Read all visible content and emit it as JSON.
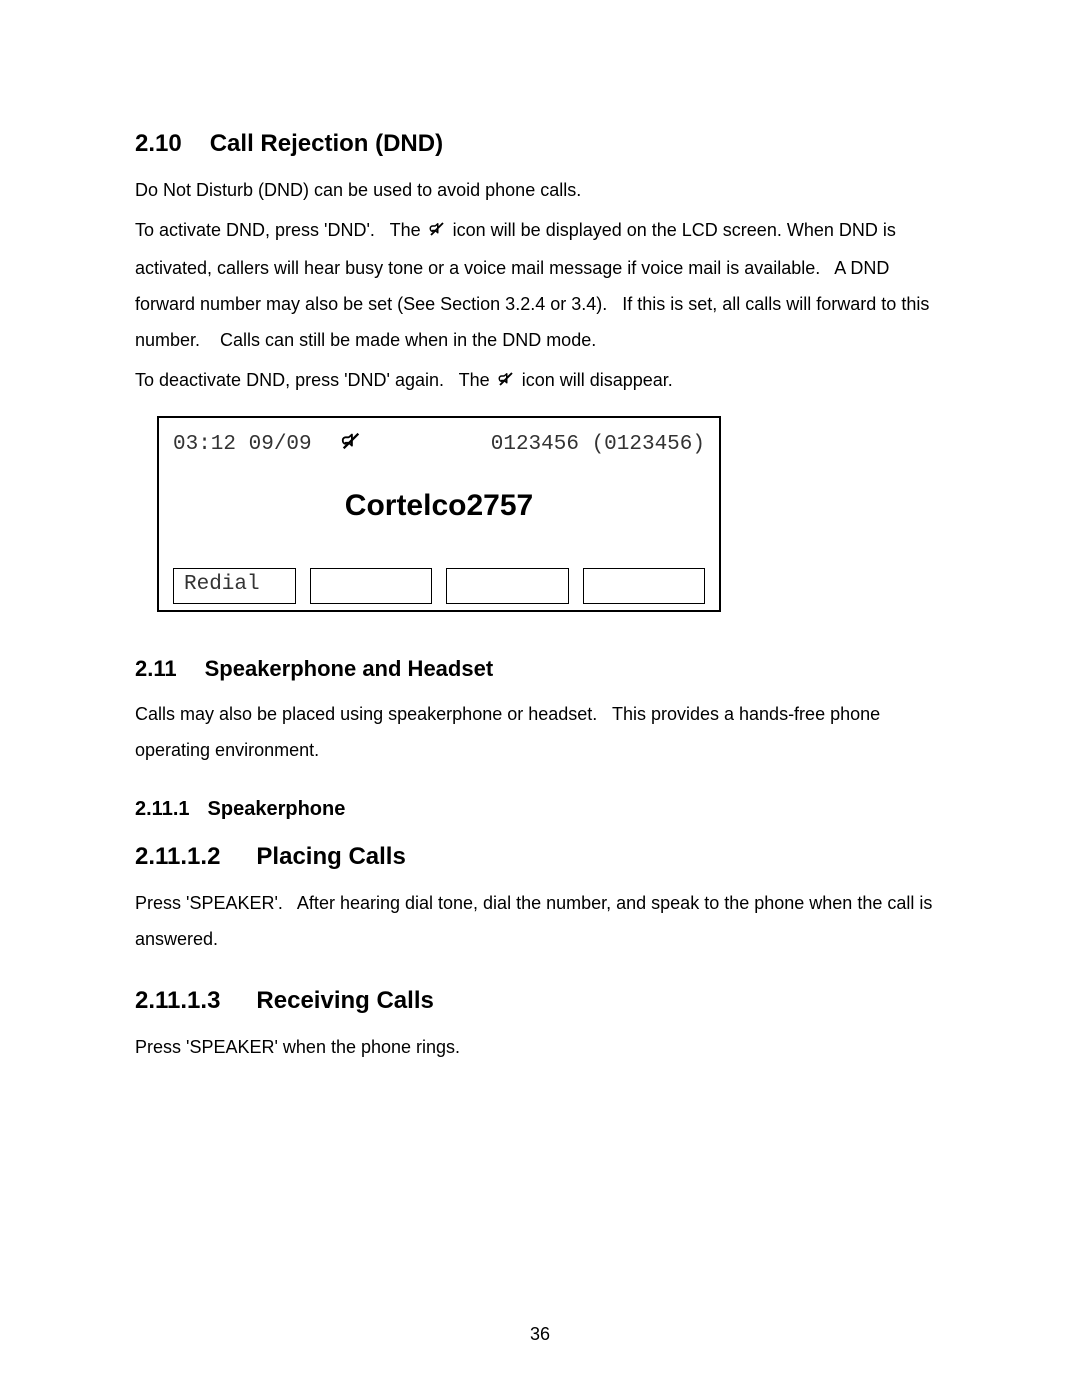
{
  "section_210": {
    "num": "2.10",
    "title": "Call Rejection (DND)",
    "p1": "Do Not Disturb (DND) can be used to avoid phone calls.",
    "p2a": "To activate DND, press 'DND'.   The ",
    "p2b": " icon will be displayed on the LCD screen. When DND is activated, callers will hear busy tone or a voice mail message if voice mail is available.   A DND forward number may also be set (See Section 3.2.4 or 3.4).   If this is set, all calls will forward to this number.    Calls can still be made when in the DND mode.",
    "p3a": "To deactivate DND, press 'DND' again.   The ",
    "p3b": " icon will disappear."
  },
  "lcd": {
    "time_date": "03:12 09/09",
    "number": "0123456 (0123456)",
    "title": "Cortelco2757",
    "softkeys": [
      "Redial",
      "",
      "",
      ""
    ]
  },
  "section_211": {
    "num": "2.11",
    "title": "Speakerphone and Headset",
    "p1": "Calls may also be placed using speakerphone or headset.   This provides a hands-free phone operating environment."
  },
  "section_2111": {
    "num": "2.11.1",
    "title": "Speakerphone"
  },
  "section_21112": {
    "num": "2.11.1.2",
    "title": "Placing Calls",
    "p1": "Press 'SPEAKER'.   After hearing dial tone, dial the number, and speak to the phone when the call is answered."
  },
  "section_21113": {
    "num": "2.11.1.3",
    "title": "Receiving Calls",
    "p1": "Press 'SPEAKER' when the phone rings."
  },
  "page_number": "36"
}
